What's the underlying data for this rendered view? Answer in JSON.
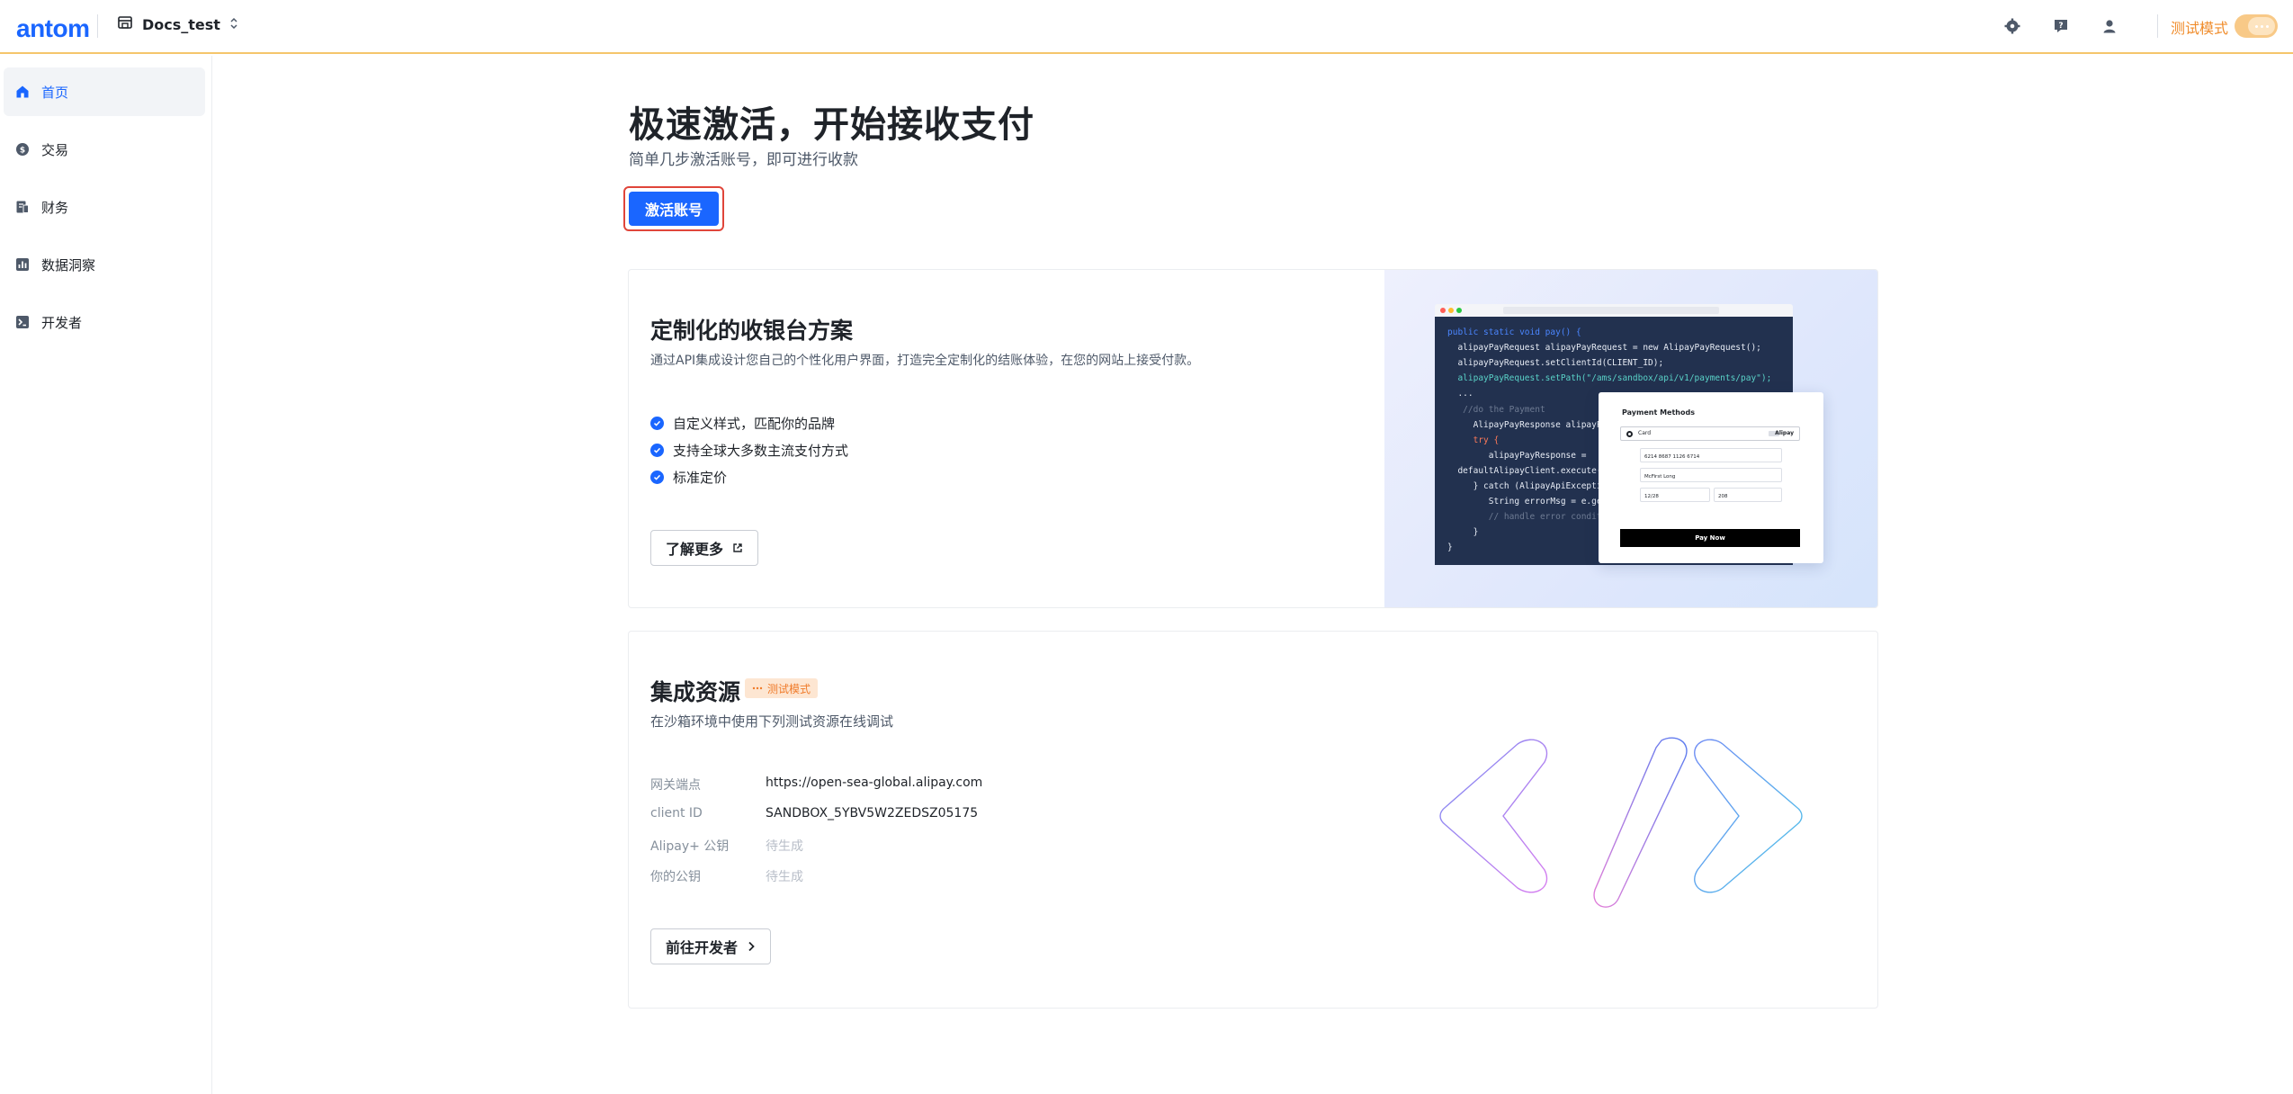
{
  "header": {
    "logo": "antom",
    "account_name": "Docs_test",
    "mode_label": "测试模式",
    "icons": [
      "settings-icon",
      "help-icon",
      "user-icon"
    ]
  },
  "sidebar": {
    "items": [
      {
        "label": "首页",
        "icon": "home-icon",
        "active": true
      },
      {
        "label": "交易",
        "icon": "transaction-icon",
        "active": false
      },
      {
        "label": "财务",
        "icon": "finance-icon",
        "active": false
      },
      {
        "label": "数据洞察",
        "icon": "chart-icon",
        "active": false
      },
      {
        "label": "开发者",
        "icon": "terminal-icon",
        "active": false
      }
    ]
  },
  "hero": {
    "title": "极速激活，开始接收支付",
    "subtitle": "简单几步激活账号，即可进行收款",
    "activate_label": "激活账号"
  },
  "checkout_card": {
    "title": "定制化的收银台方案",
    "description": "通过API集成设计您自己的个性化用户界面，打造完全定制化的结账体验，在您的网站上接受付款。",
    "features": [
      "自定义样式，匹配你的品牌",
      "支持全球大多数主流支付方式",
      "标准定价"
    ],
    "learn_more_label": "了解更多",
    "code_lines": [
      "public static void pay() {",
      "  alipayPayRequest alipayPayRequest = new AlipayPayRequest();",
      "  alipayPayRequest.setClientId(CLIENT_ID);",
      "  alipayPayRequest.setPath(\"/ams/sandbox/api/v1/payments/pay\");",
      "  ...",
      "   //do the Payment",
      "     AlipayPayResponse alipayP",
      "     try {",
      "        alipayPayResponse =",
      "  defaultAlipayClient.execute(a",
      "     } catch (AlipayApiException",
      "        String errorMsg = e.getM",
      "        // handle error conditio",
      "     }",
      "}"
    ],
    "payment_preview": {
      "title": "Payment Methods",
      "method": "Card",
      "brand": "Alipay",
      "card_number": "6214 8687 1126 6714",
      "card_name": "McFirst Long",
      "expiry": "12/28",
      "cvv": "208",
      "pay_button": "Pay Now"
    }
  },
  "integration_card": {
    "title": "集成资源",
    "badge": "测试模式",
    "subtitle": "在沙箱环境中使用下列测试资源在线调试",
    "rows": [
      {
        "label": "网关端点",
        "value": "https://open-sea-global.alipay.com",
        "pending": false
      },
      {
        "label": "client ID",
        "value": "SANDBOX_5YBV5W2ZEDSZ05175",
        "pending": false
      },
      {
        "label": "Alipay+ 公钥",
        "value": "待生成",
        "pending": true
      },
      {
        "label": "你的公钥",
        "value": "待生成",
        "pending": true
      }
    ],
    "developer_label": "前往开发者"
  },
  "colors": {
    "primary": "#1a66ff",
    "test_mode": "#f08c2b",
    "danger_outline": "#e0453a"
  }
}
